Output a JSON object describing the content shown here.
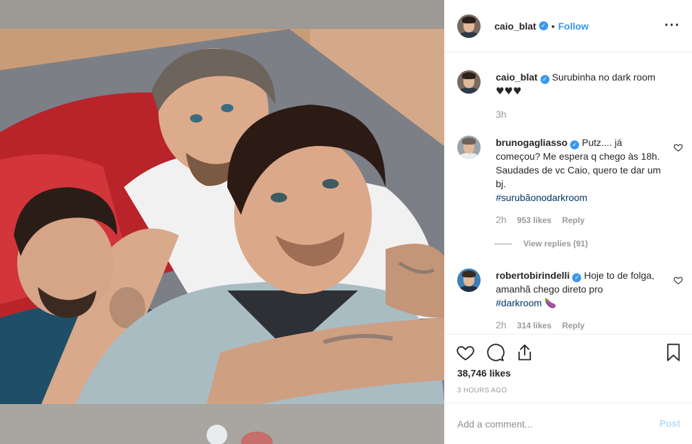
{
  "post": {
    "author": "caio_blat",
    "dot": "•",
    "follow_label": "Follow",
    "more_label": "···"
  },
  "caption": {
    "author": "caio_blat",
    "text": "Surubinha no dark room",
    "emoji": "♥♥♥",
    "time": "3h"
  },
  "comments": [
    {
      "author": "brunogagliasso",
      "text": "Putz.... já começou? Me espera q chego às 18h. Saudades de vc Caio, quero te dar um bj.",
      "hashtag": "#surubãonodarkroom",
      "time": "2h",
      "likes": "953 likes",
      "reply": "Reply"
    },
    {
      "author": "robertobirindelli",
      "text": "Hoje to de folga, amanhã chego direto pro",
      "hashtag": "#darkroom",
      "emoji": "🍆",
      "time": "2h",
      "likes": "314 likes",
      "reply": "Reply"
    }
  ],
  "view_replies": "View replies (91)",
  "stats": {
    "likes": "38,746 likes",
    "time_ago": "3 HOURS AGO"
  },
  "add_comment": {
    "placeholder": "Add a comment...",
    "post_label": "Post"
  },
  "icons": [
    "heart-icon",
    "comment-icon",
    "share-icon",
    "bookmark-icon",
    "more-icon",
    "verified-badge-icon"
  ],
  "colors": {
    "accent": "#3897f0",
    "hashtag": "#003569",
    "muted": "#999999",
    "post_disabled": "#b2dffc"
  }
}
